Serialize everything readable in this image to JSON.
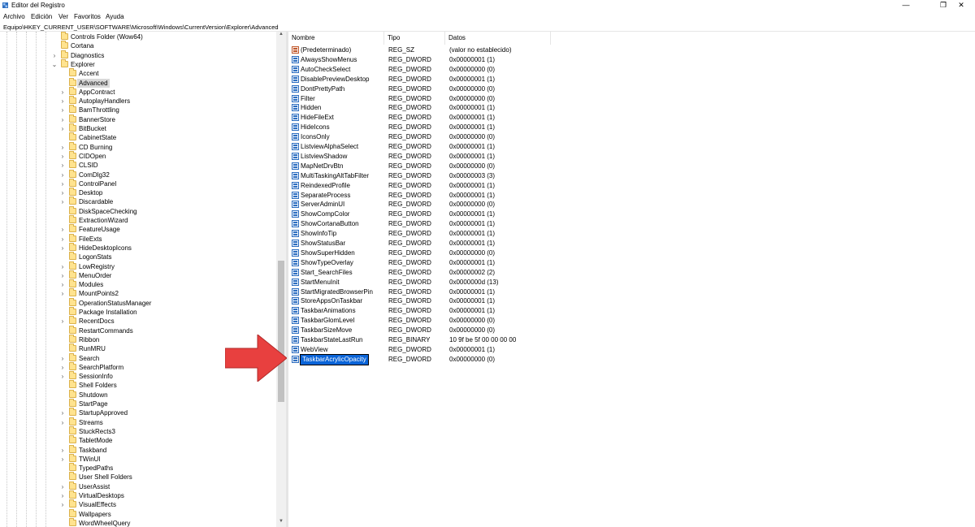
{
  "window": {
    "title": "Editor del Registro",
    "minimize_glyph": "—",
    "maximize_glyph": "❐",
    "close_glyph": "✕"
  },
  "menu": [
    "Archivo",
    "Edición",
    "Ver",
    "Favoritos",
    "Ayuda"
  ],
  "address": "Equipo\\HKEY_CURRENT_USER\\SOFTWARE\\Microsoft\\Windows\\CurrentVersion\\Explorer\\Advanced",
  "tree": {
    "parents": [
      {
        "label": "Controls Folder (Wow64)",
        "expander": ""
      },
      {
        "label": "Cortana",
        "expander": ""
      },
      {
        "label": "Diagnostics",
        "expander": "›"
      },
      {
        "label": "Explorer",
        "expander": "⌄"
      }
    ],
    "children": [
      {
        "label": "Accent",
        "expander": ""
      },
      {
        "label": "Advanced",
        "expander": "",
        "selected": true
      },
      {
        "label": "AppContract",
        "expander": "›"
      },
      {
        "label": "AutoplayHandlers",
        "expander": "›"
      },
      {
        "label": "BamThrottling",
        "expander": "›"
      },
      {
        "label": "BannerStore",
        "expander": "›"
      },
      {
        "label": "BitBucket",
        "expander": "›"
      },
      {
        "label": "CabinetState",
        "expander": ""
      },
      {
        "label": "CD Burning",
        "expander": "›"
      },
      {
        "label": "CIDOpen",
        "expander": "›"
      },
      {
        "label": "CLSID",
        "expander": "›"
      },
      {
        "label": "ComDlg32",
        "expander": "›"
      },
      {
        "label": "ControlPanel",
        "expander": "›"
      },
      {
        "label": "Desktop",
        "expander": "›"
      },
      {
        "label": "Discardable",
        "expander": "›"
      },
      {
        "label": "DiskSpaceChecking",
        "expander": ""
      },
      {
        "label": "ExtractionWizard",
        "expander": ""
      },
      {
        "label": "FeatureUsage",
        "expander": "›"
      },
      {
        "label": "FileExts",
        "expander": "›"
      },
      {
        "label": "HideDesktopIcons",
        "expander": "›"
      },
      {
        "label": "LogonStats",
        "expander": ""
      },
      {
        "label": "LowRegistry",
        "expander": "›"
      },
      {
        "label": "MenuOrder",
        "expander": "›"
      },
      {
        "label": "Modules",
        "expander": "›"
      },
      {
        "label": "MountPoints2",
        "expander": "›"
      },
      {
        "label": "OperationStatusManager",
        "expander": ""
      },
      {
        "label": "Package Installation",
        "expander": ""
      },
      {
        "label": "RecentDocs",
        "expander": "›"
      },
      {
        "label": "RestartCommands",
        "expander": ""
      },
      {
        "label": "Ribbon",
        "expander": ""
      },
      {
        "label": "RunMRU",
        "expander": ""
      },
      {
        "label": "Search",
        "expander": "›"
      },
      {
        "label": "SearchPlatform",
        "expander": "›"
      },
      {
        "label": "SessionInfo",
        "expander": "›"
      },
      {
        "label": "Shell Folders",
        "expander": ""
      },
      {
        "label": "Shutdown",
        "expander": ""
      },
      {
        "label": "StartPage",
        "expander": ""
      },
      {
        "label": "StartupApproved",
        "expander": "›"
      },
      {
        "label": "Streams",
        "expander": "›"
      },
      {
        "label": "StuckRects3",
        "expander": ""
      },
      {
        "label": "TabletMode",
        "expander": ""
      },
      {
        "label": "Taskband",
        "expander": "›"
      },
      {
        "label": "TWinUI",
        "expander": "›"
      },
      {
        "label": "TypedPaths",
        "expander": ""
      },
      {
        "label": "User Shell Folders",
        "expander": ""
      },
      {
        "label": "UserAssist",
        "expander": "›"
      },
      {
        "label": "VirtualDesktops",
        "expander": "›"
      },
      {
        "label": "VisualEffects",
        "expander": "›"
      },
      {
        "label": "Wallpapers",
        "expander": ""
      },
      {
        "label": "WordWheelQuery",
        "expander": ""
      }
    ]
  },
  "list": {
    "columns": {
      "name": "Nombre",
      "type": "Tipo",
      "data": "Datos"
    },
    "rows": [
      {
        "name": "(Predeterminado)",
        "type": "REG_SZ",
        "data": "(valor no establecido)",
        "kind": "sz"
      },
      {
        "name": "AlwaysShowMenus",
        "type": "REG_DWORD",
        "data": "0x00000001 (1)",
        "kind": "dword"
      },
      {
        "name": "AutoCheckSelect",
        "type": "REG_DWORD",
        "data": "0x00000000 (0)",
        "kind": "dword"
      },
      {
        "name": "DisablePreviewDesktop",
        "type": "REG_DWORD",
        "data": "0x00000001 (1)",
        "kind": "dword"
      },
      {
        "name": "DontPrettyPath",
        "type": "REG_DWORD",
        "data": "0x00000000 (0)",
        "kind": "dword"
      },
      {
        "name": "Filter",
        "type": "REG_DWORD",
        "data": "0x00000000 (0)",
        "kind": "dword"
      },
      {
        "name": "Hidden",
        "type": "REG_DWORD",
        "data": "0x00000001 (1)",
        "kind": "dword"
      },
      {
        "name": "HideFileExt",
        "type": "REG_DWORD",
        "data": "0x00000001 (1)",
        "kind": "dword"
      },
      {
        "name": "HideIcons",
        "type": "REG_DWORD",
        "data": "0x00000001 (1)",
        "kind": "dword"
      },
      {
        "name": "IconsOnly",
        "type": "REG_DWORD",
        "data": "0x00000000 (0)",
        "kind": "dword"
      },
      {
        "name": "ListviewAlphaSelect",
        "type": "REG_DWORD",
        "data": "0x00000001 (1)",
        "kind": "dword"
      },
      {
        "name": "ListviewShadow",
        "type": "REG_DWORD",
        "data": "0x00000001 (1)",
        "kind": "dword"
      },
      {
        "name": "MapNetDrvBtn",
        "type": "REG_DWORD",
        "data": "0x00000000 (0)",
        "kind": "dword"
      },
      {
        "name": "MultiTaskingAltTabFilter",
        "type": "REG_DWORD",
        "data": "0x00000003 (3)",
        "kind": "dword"
      },
      {
        "name": "ReindexedProfile",
        "type": "REG_DWORD",
        "data": "0x00000001 (1)",
        "kind": "dword"
      },
      {
        "name": "SeparateProcess",
        "type": "REG_DWORD",
        "data": "0x00000001 (1)",
        "kind": "dword"
      },
      {
        "name": "ServerAdminUI",
        "type": "REG_DWORD",
        "data": "0x00000000 (0)",
        "kind": "dword"
      },
      {
        "name": "ShowCompColor",
        "type": "REG_DWORD",
        "data": "0x00000001 (1)",
        "kind": "dword"
      },
      {
        "name": "ShowCortanaButton",
        "type": "REG_DWORD",
        "data": "0x00000001 (1)",
        "kind": "dword"
      },
      {
        "name": "ShowInfoTip",
        "type": "REG_DWORD",
        "data": "0x00000001 (1)",
        "kind": "dword"
      },
      {
        "name": "ShowStatusBar",
        "type": "REG_DWORD",
        "data": "0x00000001 (1)",
        "kind": "dword"
      },
      {
        "name": "ShowSuperHidden",
        "type": "REG_DWORD",
        "data": "0x00000000 (0)",
        "kind": "dword"
      },
      {
        "name": "ShowTypeOverlay",
        "type": "REG_DWORD",
        "data": "0x00000001 (1)",
        "kind": "dword"
      },
      {
        "name": "Start_SearchFiles",
        "type": "REG_DWORD",
        "data": "0x00000002 (2)",
        "kind": "dword"
      },
      {
        "name": "StartMenuInit",
        "type": "REG_DWORD",
        "data": "0x0000000d (13)",
        "kind": "dword"
      },
      {
        "name": "StartMigratedBrowserPin",
        "type": "REG_DWORD",
        "data": "0x00000001 (1)",
        "kind": "dword"
      },
      {
        "name": "StoreAppsOnTaskbar",
        "type": "REG_DWORD",
        "data": "0x00000001 (1)",
        "kind": "dword"
      },
      {
        "name": "TaskbarAnimations",
        "type": "REG_DWORD",
        "data": "0x00000001 (1)",
        "kind": "dword"
      },
      {
        "name": "TaskbarGlomLevel",
        "type": "REG_DWORD",
        "data": "0x00000000 (0)",
        "kind": "dword"
      },
      {
        "name": "TaskbarSizeMove",
        "type": "REG_DWORD",
        "data": "0x00000000 (0)",
        "kind": "dword"
      },
      {
        "name": "TaskbarStateLastRun",
        "type": "REG_BINARY",
        "data": "10 9f be 5f 00 00 00 00",
        "kind": "binary"
      },
      {
        "name": "WebView",
        "type": "REG_DWORD",
        "data": "0x00000001 (1)",
        "kind": "dword"
      },
      {
        "name": "TaskbarAcrylicOpacity",
        "type": "REG_DWORD",
        "data": "0x00000000 (0)",
        "kind": "dword",
        "editing": true
      }
    ]
  },
  "colors": {
    "arrow": "#e8403f",
    "selection": "#0a64d8",
    "folder": "#ffe38f"
  }
}
